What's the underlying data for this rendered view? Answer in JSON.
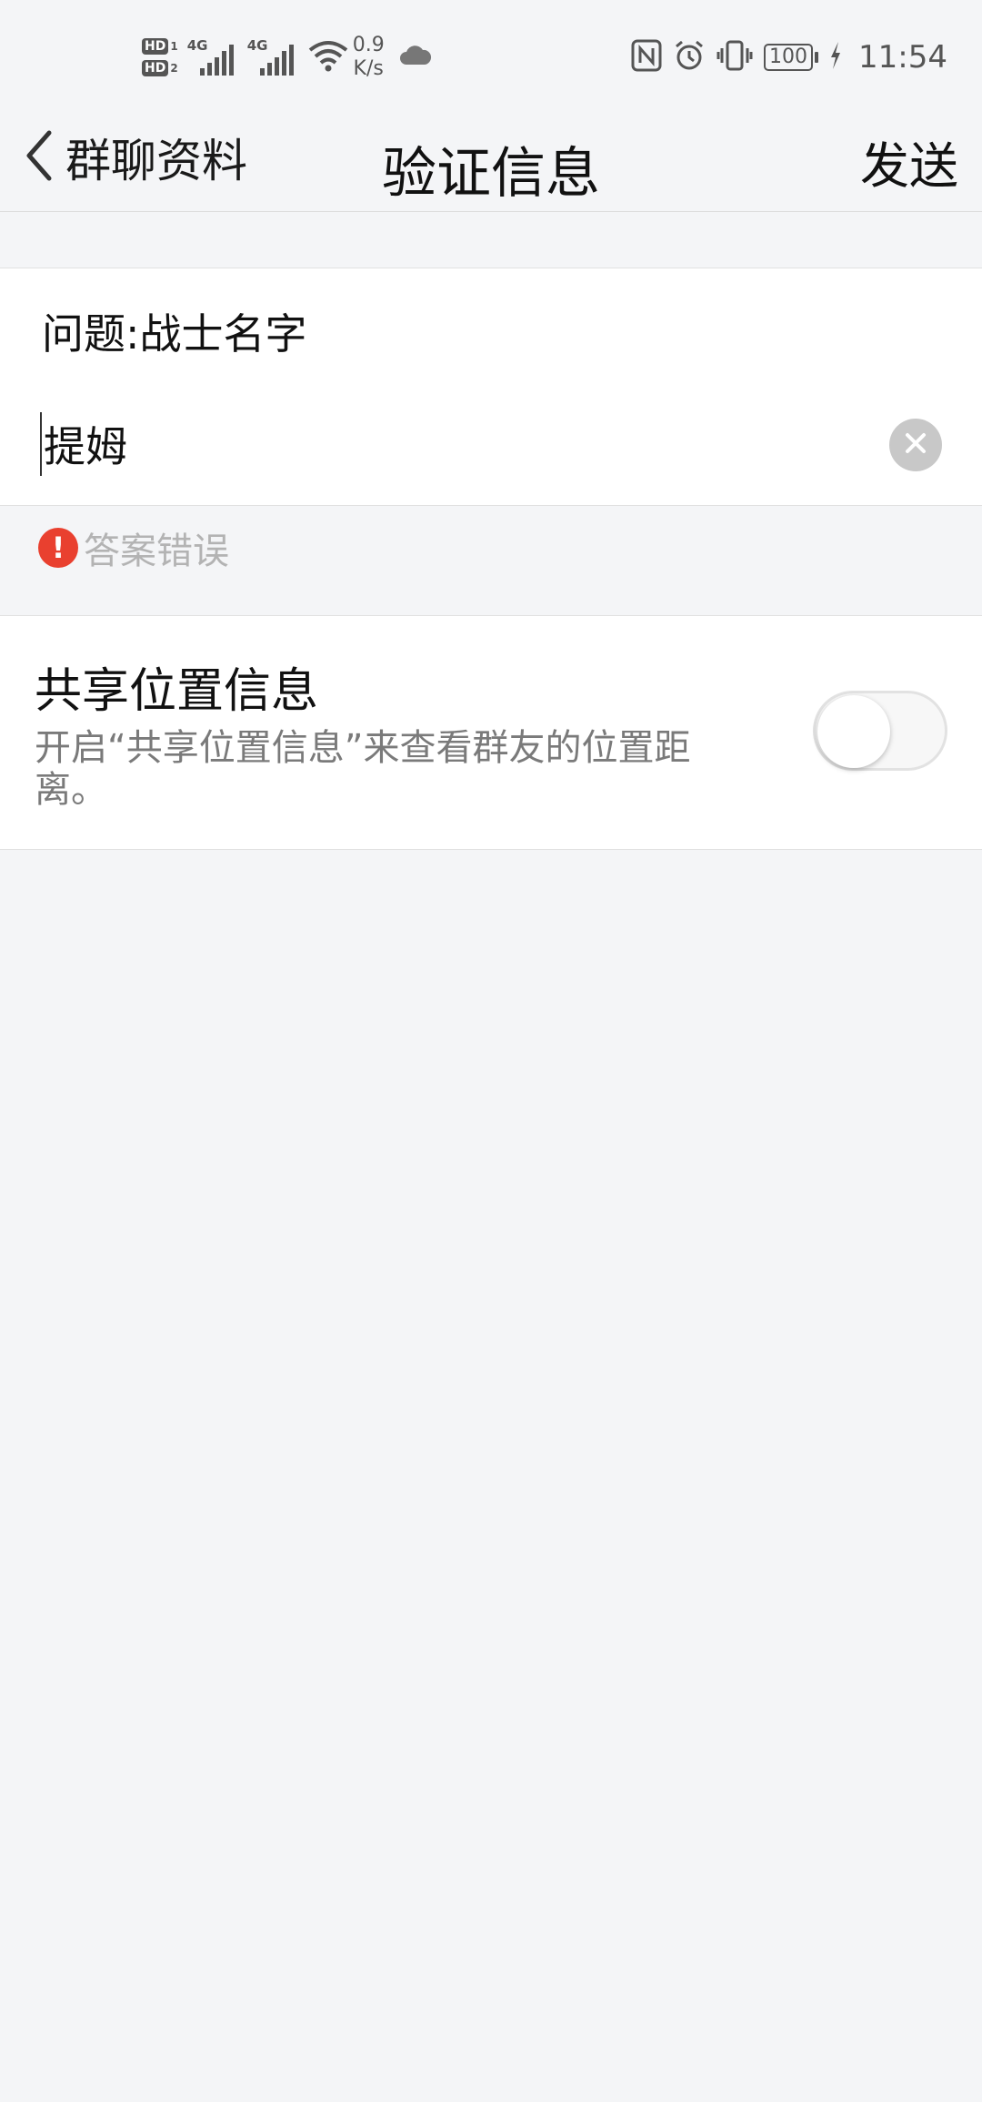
{
  "status_bar": {
    "hd1_label": "HD",
    "hd1_num": "1",
    "hd2_label": "HD",
    "hd2_num": "2",
    "sim1_net": "4G",
    "sim2_net": "4G",
    "speed_value": "0.9",
    "speed_unit": "K/s",
    "battery": "100",
    "time": "11:54",
    "icons": [
      "hd-icon",
      "signal-icon",
      "wifi-icon",
      "cloud-icon",
      "nfc-icon",
      "alarm-icon",
      "vibrate-icon",
      "battery-icon",
      "charging-icon"
    ]
  },
  "header": {
    "back_label": "群聊资料",
    "title": "验证信息",
    "send_label": "发送"
  },
  "question": {
    "text": "问题:战士名字"
  },
  "answer": {
    "value": "提姆"
  },
  "error": {
    "text": "答案错误",
    "color": "#e9402f"
  },
  "share_location": {
    "title": "共享位置信息",
    "description": "开启“共享位置信息”来查看群友的位置距离。",
    "enabled": false
  }
}
